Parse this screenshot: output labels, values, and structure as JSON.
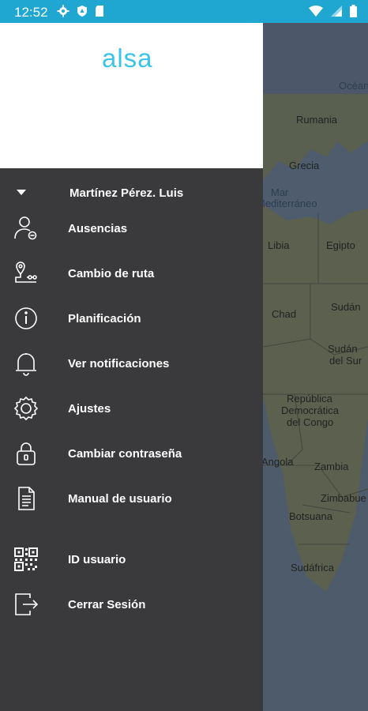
{
  "status_bar": {
    "time": "12:52",
    "left_icons": [
      "gear-icon",
      "shield-icon",
      "sd-card-icon"
    ],
    "right_icons": [
      "wifi-icon",
      "signal-icon",
      "battery-icon"
    ],
    "background": "#1fa7d1"
  },
  "drawer": {
    "logo": "alsa",
    "user_name": "Martínez Pérez. Luis",
    "items": [
      {
        "label": "Ausencias",
        "icon": "user-remove-icon"
      },
      {
        "label": "Cambio de ruta",
        "icon": "route-pin-icon"
      },
      {
        "label": "Planificación",
        "icon": "info-icon"
      },
      {
        "label": "Ver notificaciones",
        "icon": "bell-icon"
      },
      {
        "label": "Ajustes",
        "icon": "gear-icon"
      },
      {
        "label": "Cambiar contraseña",
        "icon": "lock-icon"
      },
      {
        "label": "Manual de usuario",
        "icon": "document-icon"
      },
      {
        "label": "ID usuario",
        "icon": "qr-code-icon"
      },
      {
        "label": "Cerrar Sesión",
        "icon": "logout-icon"
      }
    ],
    "colors": {
      "background": "#3a3a3c",
      "header": "#ffffff",
      "logo": "#3cc3e8"
    }
  },
  "map": {
    "labels": [
      "Océano",
      "Rumania",
      "Grecia",
      "Mar",
      "Mediterráneo",
      "Libia",
      "Egipto",
      "Chad",
      "Sudán",
      "Sudán",
      "del Sur",
      "República",
      "Democrática",
      "del Congo",
      "Angola",
      "Zambia",
      "Zimbabue",
      "Botsuana",
      "Sudáfrica"
    ]
  }
}
